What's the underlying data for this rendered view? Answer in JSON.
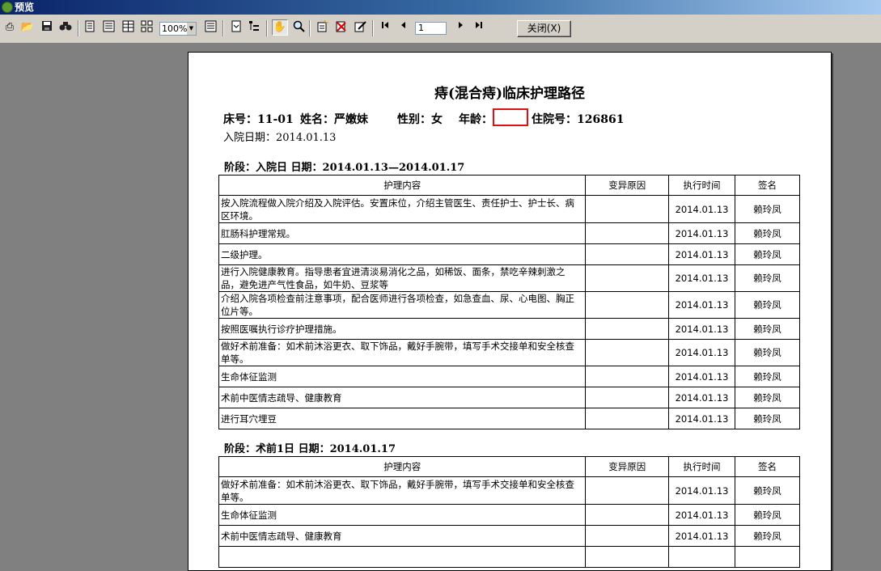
{
  "window": {
    "title": "预览"
  },
  "toolbar": {
    "icons": [
      "print-icon",
      "open-icon",
      "save-icon",
      "find-icon",
      "single-page-icon",
      "two-page-icon",
      "four-page-icon",
      "multi-page-icon",
      "page-setup-icon",
      "outline-icon",
      "tree-icon",
      "hand-icon",
      "zoom-icon",
      "new-icon",
      "delete-icon",
      "edit-icon",
      "first-page-icon",
      "prev-page-icon",
      "next-page-icon",
      "last-page-icon"
    ],
    "zoom": "100%",
    "page": "1",
    "close_label": "关闭(X)"
  },
  "document": {
    "title": "痔(混合痔)临床护理路径",
    "patient": {
      "bed": "床号：11-01",
      "name": "姓名：严嫩妹",
      "sex": "性别：女",
      "age": "年龄：",
      "admission_no": "住院号：126861",
      "admission_date": "入院日期：2014.01.13"
    },
    "headers": [
      "护理内容",
      "变异原因",
      "执行时间",
      "签名"
    ],
    "stage1": {
      "label": "阶段：入院日  日期：2014.01.13—2014.01.17",
      "rows": [
        {
          "content": "按入院流程做入院介绍及入院评估。安置床位，介绍主管医生、责任护士、护士长、病区环境。",
          "reason": "",
          "time": "2014.01.13",
          "sign": "赖玲凤"
        },
        {
          "content": "肛肠科护理常规。",
          "reason": "",
          "time": "2014.01.13",
          "sign": "赖玲凤"
        },
        {
          "content": "二级护理。",
          "reason": "",
          "time": "2014.01.13",
          "sign": "赖玲凤"
        },
        {
          "content": "进行入院健康教育。指导患者宜进清淡易消化之品，如稀饭、面条，禁吃辛辣刺激之品，避免进产气性食品，如牛奶、豆浆等",
          "reason": "",
          "time": "2014.01.13",
          "sign": "赖玲凤"
        },
        {
          "content": "介绍入院各项检查前注意事项，配合医师进行各项检查，如急查血、尿、心电图、胸正位片等。",
          "reason": "",
          "time": "2014.01.13",
          "sign": "赖玲凤"
        },
        {
          "content": "按照医嘱执行诊疗护理措施。",
          "reason": "",
          "time": "2014.01.13",
          "sign": "赖玲凤"
        },
        {
          "content": "做好术前准备：如术前沐浴更衣、取下饰品，戴好手腕带，填写手术交接单和安全核查单等。",
          "reason": "",
          "time": "2014.01.13",
          "sign": "赖玲凤"
        },
        {
          "content": "生命体征监测",
          "reason": "",
          "time": "2014.01.13",
          "sign": "赖玲凤"
        },
        {
          "content": "术前中医情志疏导、健康教育",
          "reason": "",
          "time": "2014.01.13",
          "sign": "赖玲凤"
        },
        {
          "content": "进行耳穴埋豆",
          "reason": "",
          "time": "2014.01.13",
          "sign": "赖玲凤"
        }
      ]
    },
    "stage2": {
      "label": "阶段：术前1日  日期：2014.01.17",
      "rows": [
        {
          "content": "做好术前准备：如术前沐浴更衣、取下饰品，戴好手腕带，填写手术交接单和安全核查单等。",
          "reason": "",
          "time": "2014.01.13",
          "sign": "赖玲凤"
        },
        {
          "content": "生命体征监测",
          "reason": "",
          "time": "2014.01.13",
          "sign": "赖玲凤"
        },
        {
          "content": "术前中医情志疏导、健康教育",
          "reason": "",
          "time": "2014.01.13",
          "sign": "赖玲凤"
        },
        {
          "content": "",
          "reason": "",
          "time": "",
          "sign": ""
        }
      ]
    }
  }
}
